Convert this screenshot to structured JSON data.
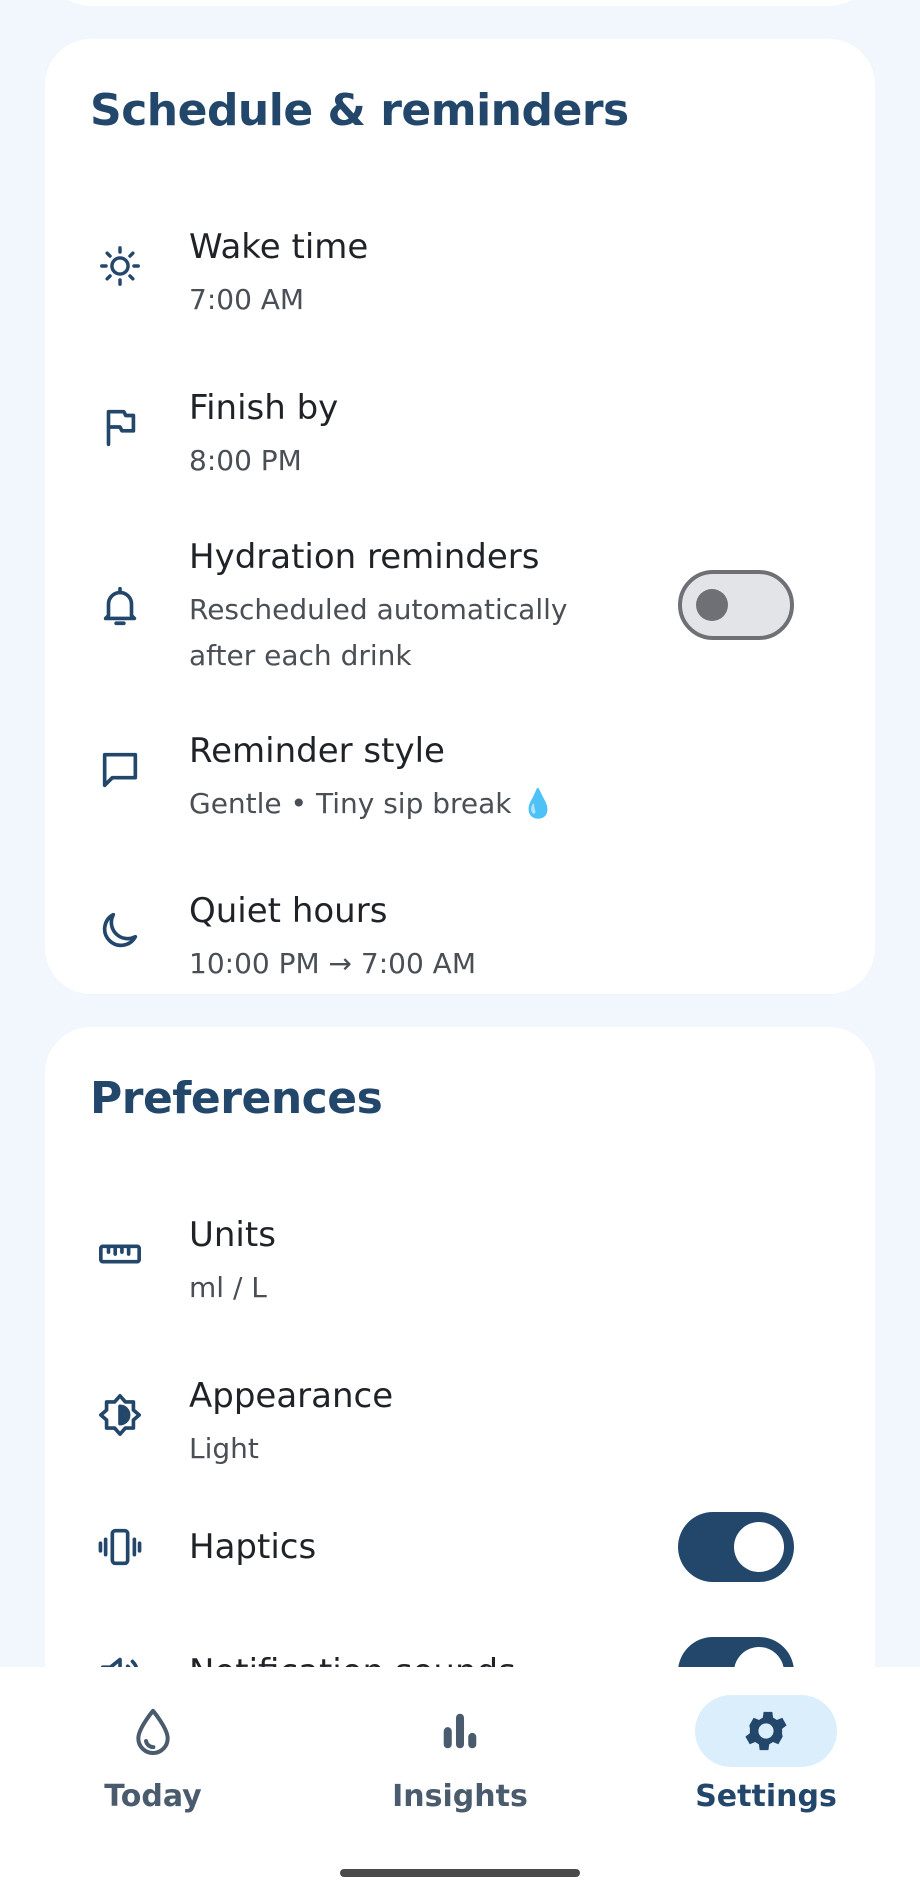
{
  "schedule": {
    "title": "Schedule & reminders",
    "wake": {
      "label": "Wake time",
      "value": "7:00 AM"
    },
    "finish": {
      "label": "Finish by",
      "value": "8:00 PM"
    },
    "reminders": {
      "label": "Hydration reminders",
      "value": "Rescheduled automatically after each drink",
      "enabled": false
    },
    "style": {
      "label": "Reminder style",
      "value": "Gentle • Tiny sip break",
      "emoji": "💧"
    },
    "quiet": {
      "label": "Quiet hours",
      "value": "10:00 PM → 7:00 AM"
    }
  },
  "preferences": {
    "title": "Preferences",
    "units": {
      "label": "Units",
      "value": "ml / L"
    },
    "appearance": {
      "label": "Appearance",
      "value": "Light"
    },
    "haptics": {
      "label": "Haptics",
      "enabled": true
    },
    "sounds": {
      "label": "Notification sounds",
      "enabled": true
    }
  },
  "nav": {
    "today": "Today",
    "insights": "Insights",
    "settings": "Settings",
    "active": "settings"
  },
  "colors": {
    "accent": "#23476b",
    "background": "#f2f7fd",
    "active_pill": "#dbeefc",
    "toggle_off": "#e3e4e8"
  }
}
